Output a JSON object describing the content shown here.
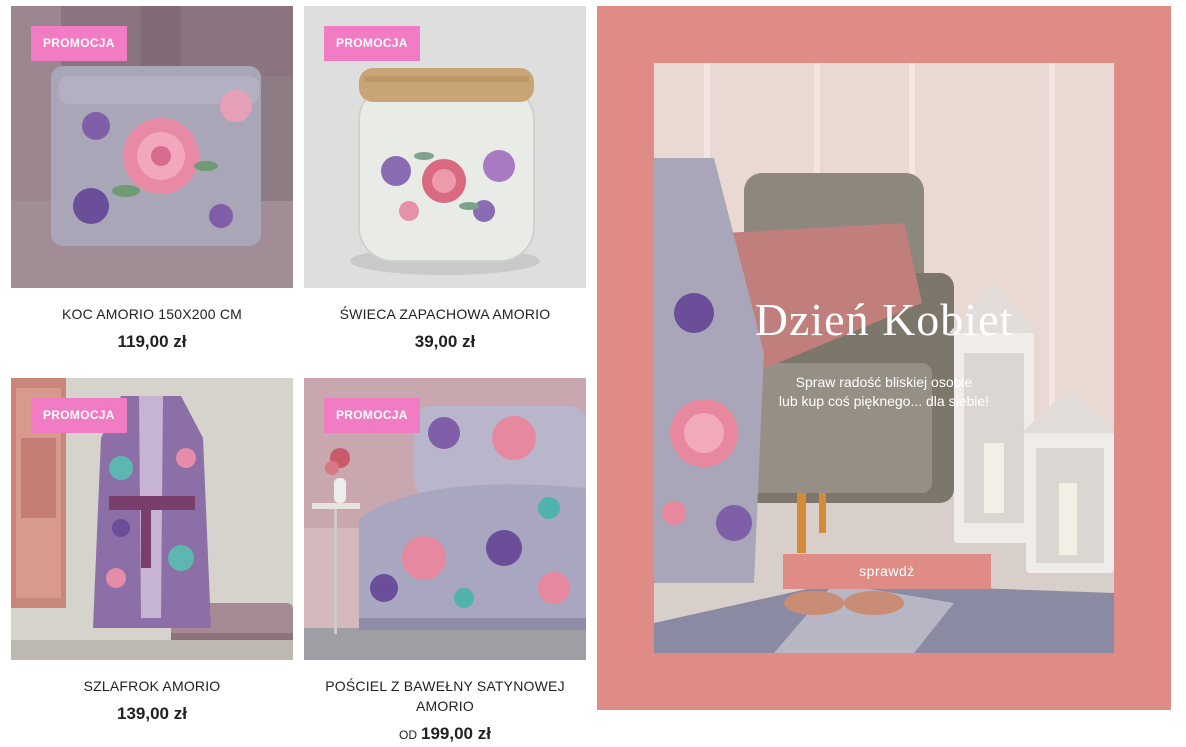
{
  "products": [
    {
      "badge": "PROMOCJA",
      "name": "KOC AMORIO 150X200 CM",
      "price": "119,00 zł",
      "price_prefix": ""
    },
    {
      "badge": "PROMOCJA",
      "name": "ŚWIECA ZAPACHOWA AMORIO",
      "price": "39,00 zł",
      "price_prefix": ""
    },
    {
      "badge": "PROMOCJA",
      "name": "SZLAFROK AMORIO",
      "price": "139,00 zł",
      "price_prefix": ""
    },
    {
      "badge": "PROMOCJA",
      "name": "POŚCIEL Z BAWEŁNY SATYNOWEJ AMORIO",
      "price": "199,00 zł",
      "price_prefix": "OD"
    }
  ],
  "banner": {
    "headline": "Dzień Kobiet",
    "subtitle_line1": "Spraw radość bliskiej osobie",
    "subtitle_line2": "lub kup coś pięknego... dla siebie!",
    "cta": "sprawdź"
  },
  "colors": {
    "badge": "#f27cc3",
    "banner_frame": "#df8b86"
  }
}
